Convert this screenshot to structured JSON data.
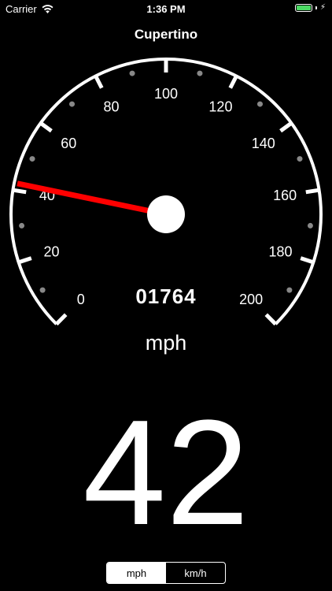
{
  "status_bar": {
    "carrier": "Carrier",
    "time": "1:36 PM",
    "battery_level": 1.0,
    "bolt": "⚡"
  },
  "location": "Cupertino",
  "gauge": {
    "min": 0,
    "max": 200,
    "needle_value": 42,
    "labels": [
      "0",
      "20",
      "40",
      "60",
      "80",
      "100",
      "120",
      "140",
      "160",
      "180",
      "200"
    ],
    "accent_color": "#ff0000",
    "tick_color": "#ffffff",
    "dot_color": "#888888"
  },
  "odometer": "01764",
  "unit_label": "mph",
  "speed": "42",
  "segmented": {
    "options": [
      "mph",
      "km/h"
    ],
    "selected": "mph"
  },
  "colors": {
    "background": "#000000",
    "foreground": "#ffffff",
    "battery": "#4cd964"
  }
}
